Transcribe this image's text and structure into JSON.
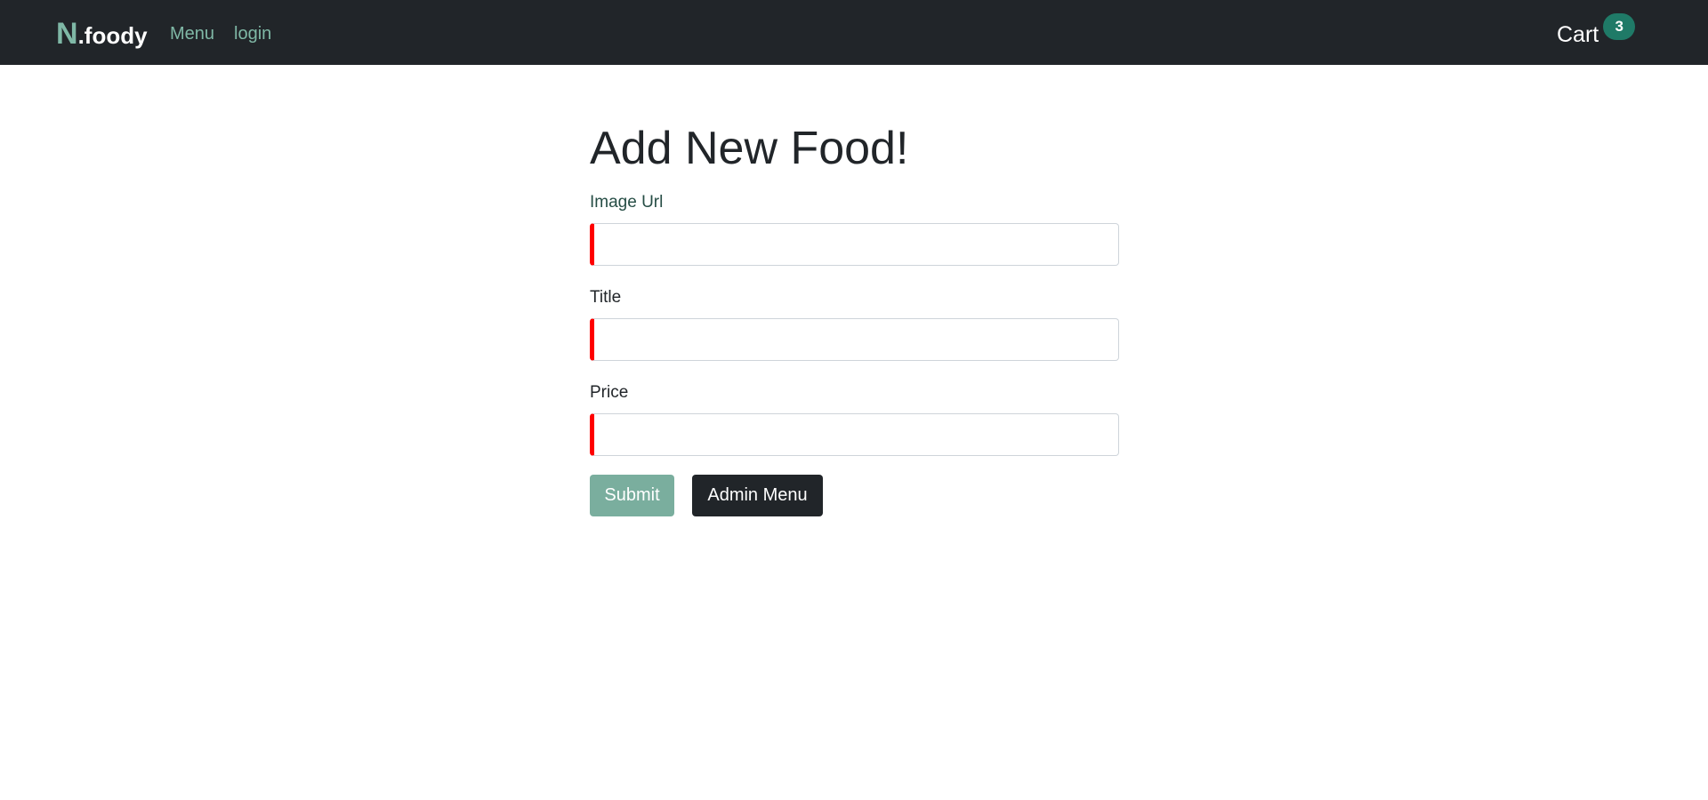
{
  "navbar": {
    "brand_letter": "N",
    "brand_rest": ".foody",
    "links": [
      {
        "label": "Menu"
      },
      {
        "label": "login"
      }
    ],
    "cart": {
      "label": "Cart",
      "count": "3"
    }
  },
  "form": {
    "title": "Add New Food!",
    "fields": [
      {
        "label": "Image Url",
        "value": "",
        "placeholder": ""
      },
      {
        "label": "Title",
        "value": "",
        "placeholder": ""
      },
      {
        "label": "Price",
        "value": "",
        "placeholder": ""
      }
    ],
    "submit_label": "Submit",
    "admin_menu_label": "Admin Menu"
  },
  "colors": {
    "navbar_bg": "#212529",
    "brand_accent": "#7fb8a6",
    "badge_bg": "#1f7a67",
    "invalid_border": "#ff0000",
    "submit_bg": "#7aae9e",
    "admin_bg": "#212529"
  }
}
